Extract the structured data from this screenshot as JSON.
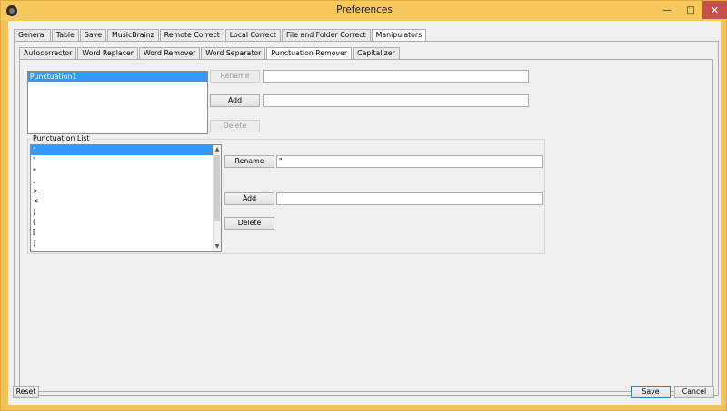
{
  "window": {
    "title": "Preferences"
  },
  "tabs_top": [
    "General",
    "Table",
    "Save",
    "MusicBrainz",
    "Remote Correct",
    "Local Correct",
    "File and Folder Correct",
    "Manipulators"
  ],
  "tabs_sub": [
    "Autocorrector",
    "Word Replacer",
    "Word Remover",
    "Word Separator",
    "Punctuation Remover",
    "Capitalizer"
  ],
  "upper": {
    "list": [
      "Punctuation1"
    ],
    "rename_label": "Rename",
    "add_label": "Add",
    "delete_label": "Delete",
    "rename_value": "",
    "add_value": ""
  },
  "punct": {
    "group_title": "Punctuation List",
    "items": [
      "\"",
      "'",
      "*",
      ".",
      ">",
      "<",
      ")",
      "(",
      "[",
      "]"
    ],
    "rename_label": "Rename",
    "add_label": "Add",
    "delete_label": "Delete",
    "rename_value": "\"",
    "add_value": ""
  },
  "footer": {
    "reset": "Reset",
    "save": "Save",
    "cancel": "Cancel"
  },
  "colors": {
    "titlebar": "#f6c85e",
    "selection": "#3399ff",
    "close": "#c7504a"
  }
}
